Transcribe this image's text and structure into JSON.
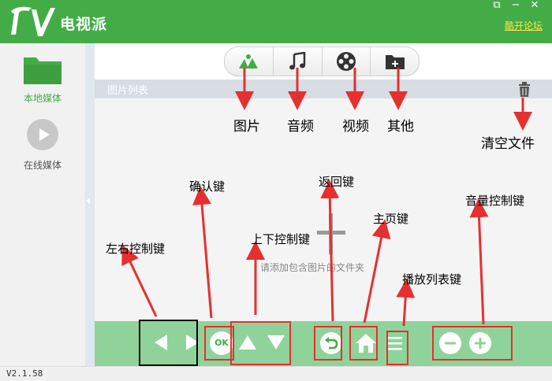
{
  "window": {
    "app_name": "电视派",
    "forum_link": "酷开论坛",
    "version": "V2.1.58"
  },
  "sidebar": {
    "items": [
      {
        "label": "本地媒体",
        "icon": "folder-icon",
        "active": true
      },
      {
        "label": "在线媒体",
        "icon": "play-icon",
        "active": false
      }
    ]
  },
  "categories": [
    {
      "icon": "image-icon"
    },
    {
      "icon": "music-note-icon"
    },
    {
      "icon": "film-reel-icon"
    },
    {
      "icon": "folder-plus-icon"
    }
  ],
  "list": {
    "title": "图片列表",
    "empty_hint": "请添加包含图片的文件夹"
  },
  "annotations": {
    "picture": "图片",
    "audio": "音频",
    "video": "视频",
    "other": "其他",
    "clear": "清空文件",
    "confirm_key": "确认键",
    "back_key": "返回键",
    "home_key": "主页键",
    "volume_key": "音量控制键",
    "lr_key": "左右控制键",
    "ud_key": "上下控制键",
    "playlist_key": "播放列表键"
  },
  "remote": {
    "ok_label": "OK"
  },
  "colors": {
    "brand_green": "#43ac46",
    "remote_bar": "#8fd39a",
    "annotation_red": "#e53030",
    "forum_link": "#ffe44a"
  }
}
